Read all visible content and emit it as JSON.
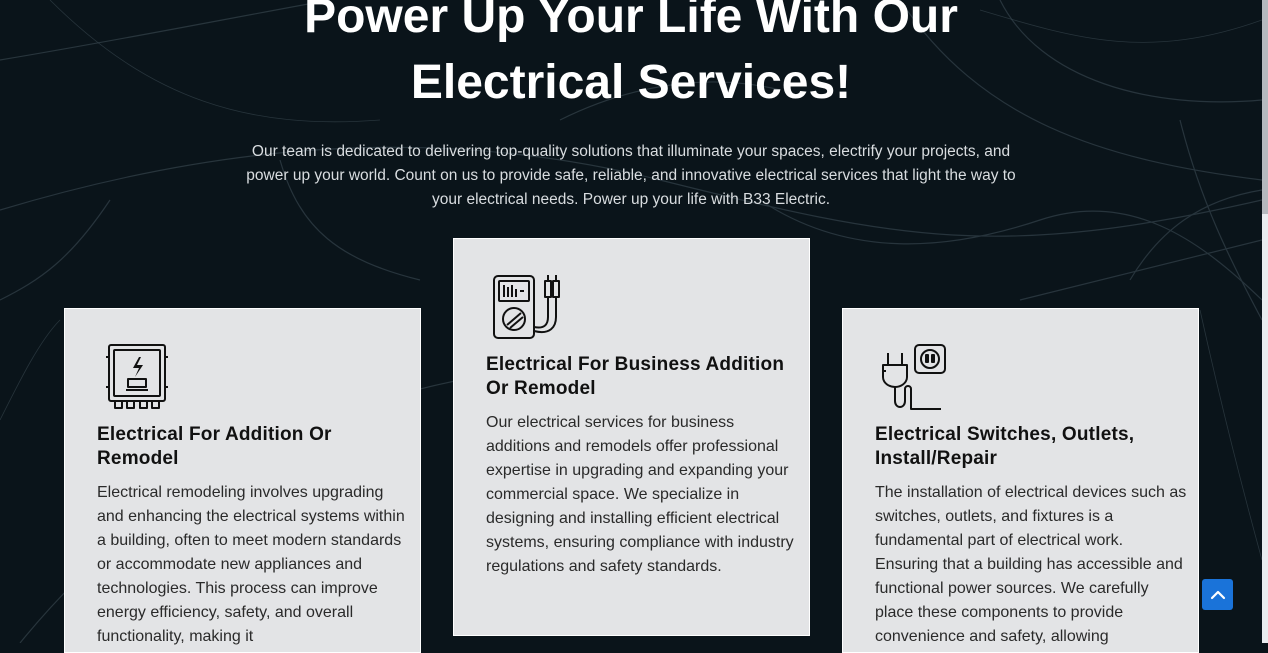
{
  "hero": {
    "title_line1": "Power Up Your Life With Our",
    "title_line2": "Electrical Services!",
    "description": "Our team is dedicated to delivering top-quality solutions that illuminate your spaces, electrify your projects, and power up your world. Count on us to provide safe, reliable, and innovative electrical services that light the way to your electrical needs. Power up your life with B33 Electric."
  },
  "cards": [
    {
      "icon": "electrical-panel-icon",
      "title": "Electrical For Addition Or Remodel",
      "text": "Electrical remodeling involves upgrading and enhancing the electrical systems within a building, often to meet modern standards or accommodate new appliances and technologies. This process can improve energy efficiency, safety, and overall functionality, making it"
    },
    {
      "icon": "multimeter-icon",
      "title": "Electrical For Business Addition Or Remodel",
      "text": "Our electrical services for business additions and remodels offer professional expertise in upgrading and expanding your commercial space. We specialize in designing and installing efficient electrical systems, ensuring compliance with industry regulations and safety standards."
    },
    {
      "icon": "plug-outlet-icon",
      "title": "Electrical Switches, Outlets, Install/Repair",
      "text": "The installation of electrical devices such as switches, outlets, and fixtures is a fundamental part of electrical work. Ensuring that a building has accessible and functional power sources. We carefully place these components to provide convenience and safety, allowing"
    }
  ],
  "colors": {
    "background": "#0a141a",
    "card": "#e3e4e6",
    "accent": "#1a73d9"
  },
  "back_to_top": {
    "icon": "chevron-up-icon"
  }
}
